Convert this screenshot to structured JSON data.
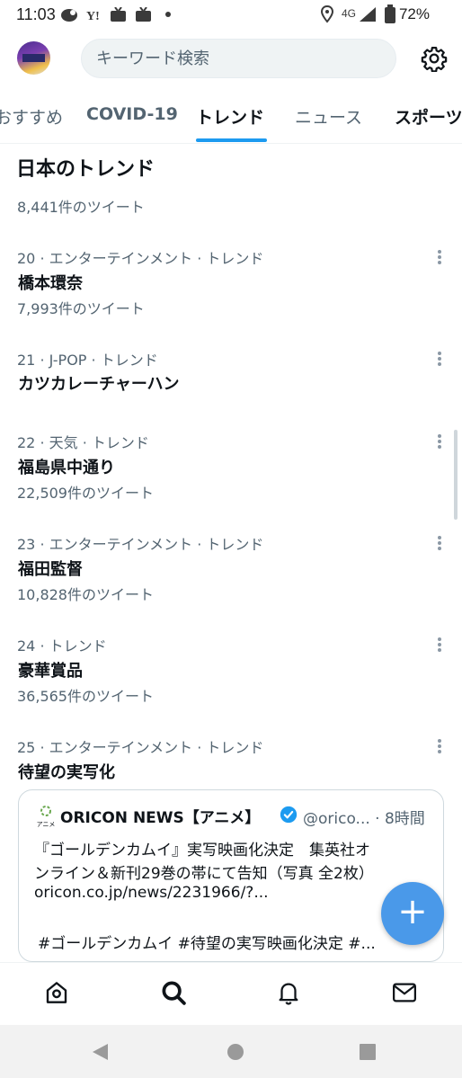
{
  "status_bar": {
    "time": "11:03",
    "network": "4G",
    "battery": "72%"
  },
  "header": {
    "search_placeholder": "キーワード検索"
  },
  "tabs": [
    {
      "label": "おすすめ",
      "active": false
    },
    {
      "label": "COVID-19",
      "active": false
    },
    {
      "label": "トレンド",
      "active": true
    },
    {
      "label": "ニュース",
      "active": false
    },
    {
      "label": "スポーツ",
      "active": false
    }
  ],
  "section": {
    "title": "日本のトレンド",
    "top_count": "8,441件のツイート"
  },
  "trends": [
    {
      "meta": "20 · エンターテインメント · トレンド",
      "name": "橋本環奈",
      "count": "7,993件のツイート"
    },
    {
      "meta": "21 · J-POP · トレンド",
      "name": "カツカレーチャーハン",
      "count": ""
    },
    {
      "meta": "22 · 天気 · トレンド",
      "name": "福島県中通り",
      "count": "22,509件のツイート"
    },
    {
      "meta": "23 · エンターテインメント · トレンド",
      "name": "福田監督",
      "count": "10,828件のツイート"
    },
    {
      "meta": "24 · トレンド",
      "name": "豪華賞品",
      "count": "36,565件のツイート"
    },
    {
      "meta": "25 · エンターテインメント · トレンド",
      "name": "待望の実写化",
      "count": ""
    }
  ],
  "tweet_card": {
    "logo_text": "アニメ",
    "author": "ORICON NEWS【アニメ】",
    "handle": "@orico... · 8時間",
    "line1": "『ゴールデンカムイ』実写映画化決定　集英社オ",
    "line2": "ンライン＆新刊29巻の帯にて告知（写真 全2枚）",
    "line3": "oricon.co.jp/news/2231966/?...",
    "line4": "#ゴールデンカムイ #待望の実写映画化決定 #..."
  },
  "colors": {
    "accent": "#1d9bf0",
    "fab": "#4a99e9",
    "secondary_text": "#536471",
    "verified": "#1d9bf0"
  }
}
